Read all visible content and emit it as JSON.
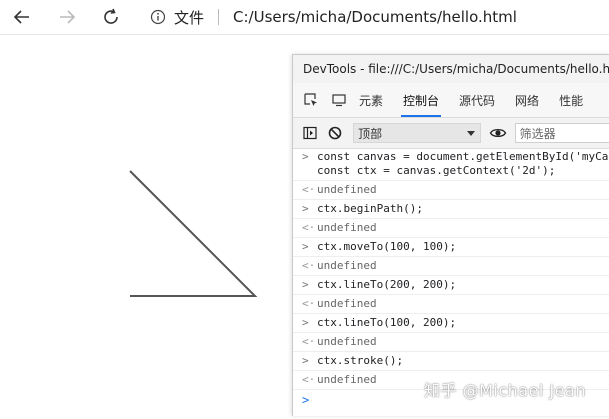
{
  "browser": {
    "back_icon": "back-arrow-icon",
    "forward_icon": "forward-arrow-icon",
    "refresh_icon": "refresh-icon",
    "site_info_label": "文件",
    "url": "C:/Users/micha/Documents/hello.html"
  },
  "devtools": {
    "title": "DevTools - file:///C:/Users/micha/Documents/hello.html",
    "tabs": [
      {
        "label": "元素"
      },
      {
        "label": "控制台"
      },
      {
        "label": "源代码"
      },
      {
        "label": "网络"
      },
      {
        "label": "性能"
      }
    ],
    "active_tab": "控制台",
    "toolbar": {
      "context_value": "顶部",
      "filter_placeholder": "筛选器"
    },
    "console": {
      "entries": [
        {
          "input": "const canvas = document.getElementById('myCa",
          "input2": "const ctx = canvas.getContext('2d');",
          "output": "undefined"
        },
        {
          "input": "ctx.beginPath();",
          "output": "undefined"
        },
        {
          "input": "ctx.moveTo(100, 100);",
          "output": "undefined"
        },
        {
          "input": "ctx.lineTo(200, 200);",
          "output": "undefined"
        },
        {
          "input": "ctx.lineTo(100, 200);",
          "output": "undefined"
        },
        {
          "input": "ctx.stroke();",
          "output": "undefined"
        }
      ]
    }
  },
  "watermark": "知乎 @Michael Jean",
  "colors": {
    "accent": "#1a73e8",
    "stroke": "#555555"
  }
}
